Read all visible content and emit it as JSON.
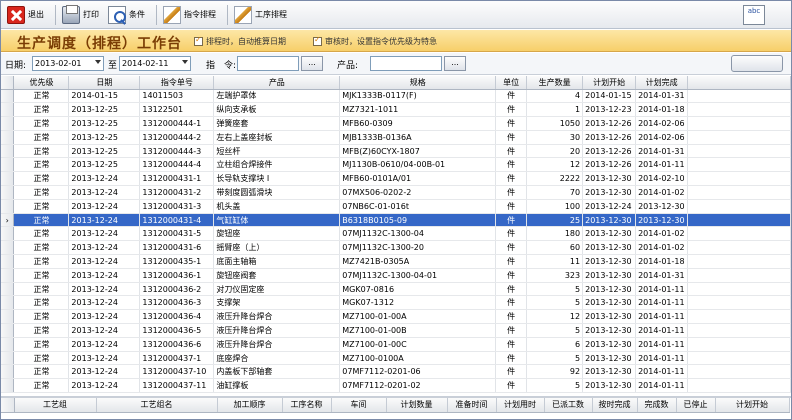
{
  "toolbar": {
    "exit": "退出",
    "print": "打印",
    "condition": "条件",
    "instruction_sort": "指令排程",
    "process_sort": "工序排程",
    "spell_icon_text": "abc"
  },
  "title": {
    "page_title": "生产调度（排程）工作台",
    "option1": "排程时，自动推算日期",
    "option2": "审核时，设置指令优先级为特急"
  },
  "filter": {
    "date_label": "日期:",
    "date_from": "2013-02-01",
    "to_label": "至",
    "date_to": "2014-02-11",
    "instruction_label": "指　令:",
    "dots": "...",
    "product_label": "产品:"
  },
  "grid": {
    "columns": [
      "优先级",
      "日期",
      "指令单号",
      "产品",
      "规格",
      "单位",
      "生产数量",
      "计划开始",
      "计划完成"
    ],
    "selected_index": 9,
    "rows": [
      [
        "正常",
        "2014-01-15",
        "14011503",
        "左端护罩体",
        "MJK1333B-0117(F)",
        "件",
        "4",
        "2014-01-15",
        "2014-01-31"
      ],
      [
        "正常",
        "2013-12-25",
        "13122501",
        "纵向支承板",
        "MZ7321-1011",
        "件",
        "1",
        "2013-12-23",
        "2014-01-18"
      ],
      [
        "正常",
        "2013-12-25",
        "1312000444-1",
        "弹簧座套",
        "MFB60-0309",
        "件",
        "1050",
        "2013-12-26",
        "2014-02-06"
      ],
      [
        "正常",
        "2013-12-25",
        "1312000444-2",
        "左右上盖座封板",
        "MJB1333B-0136A",
        "件",
        "30",
        "2013-12-26",
        "2014-02-06"
      ],
      [
        "正常",
        "2013-12-25",
        "1312000444-3",
        "短丝杆",
        "MFB(Z)60CYX-1807",
        "件",
        "20",
        "2013-12-26",
        "2014-01-31"
      ],
      [
        "正常",
        "2013-12-25",
        "1312000444-4",
        "立柱组合焊接件",
        "MJ1130B-0610/04-00B-01",
        "件",
        "12",
        "2013-12-26",
        "2014-01-11"
      ],
      [
        "正常",
        "2013-12-24",
        "1312000431-1",
        "长导轨支撑块 I",
        "MFB60-0101A/01",
        "件",
        "2222",
        "2013-12-30",
        "2014-02-10"
      ],
      [
        "正常",
        "2013-12-24",
        "1312000431-2",
        "带刻度圆弧滑块",
        "07MX506-0202-2",
        "件",
        "70",
        "2013-12-30",
        "2014-01-02"
      ],
      [
        "正常",
        "2013-12-24",
        "1312000431-3",
        "机头盖",
        "07NB6C-01-016t",
        "件",
        "100",
        "2013-12-24",
        "2013-12-30"
      ],
      [
        "正常",
        "2013-12-24",
        "1312000431-4",
        "气缸缸体",
        "B6318B0105-09",
        "件",
        "25",
        "2013-12-30",
        "2013-12-30"
      ],
      [
        "正常",
        "2013-12-24",
        "1312000431-5",
        "旋钮座",
        "07MJ1132C-1300-04",
        "件",
        "180",
        "2013-12-30",
        "2014-01-02"
      ],
      [
        "正常",
        "2013-12-24",
        "1312000431-6",
        "摇臂座（上）",
        "07MJ1132C-1300-20",
        "件",
        "60",
        "2013-12-30",
        "2014-01-02"
      ],
      [
        "正常",
        "2013-12-24",
        "1312000435-1",
        "底面主轴箱",
        "MZ7421B-0305A",
        "件",
        "11",
        "2013-12-30",
        "2014-01-18"
      ],
      [
        "正常",
        "2013-12-24",
        "1312000436-1",
        "旋钮座阀套",
        "07MJ1132C-1300-04-01",
        "件",
        "323",
        "2013-12-30",
        "2014-01-31"
      ],
      [
        "正常",
        "2013-12-24",
        "1312000436-2",
        "对刀仪固定座",
        "MGK07-0816",
        "件",
        "5",
        "2013-12-30",
        "2014-01-11"
      ],
      [
        "正常",
        "2013-12-24",
        "1312000436-3",
        "支撑架",
        "MGK07-1312",
        "件",
        "5",
        "2013-12-30",
        "2014-01-11"
      ],
      [
        "正常",
        "2013-12-24",
        "1312000436-4",
        "液压升降台焊合",
        "MZ7100-01-00A",
        "件",
        "12",
        "2013-12-30",
        "2014-01-11"
      ],
      [
        "正常",
        "2013-12-24",
        "1312000436-5",
        "液压升降台焊合",
        "MZ7100-01-00B",
        "件",
        "5",
        "2013-12-30",
        "2014-01-11"
      ],
      [
        "正常",
        "2013-12-24",
        "1312000436-6",
        "液压升降台焊合",
        "MZ7100-01-00C",
        "件",
        "6",
        "2013-12-30",
        "2014-01-11"
      ],
      [
        "正常",
        "2013-12-24",
        "1312000437-1",
        "底座焊合",
        "MZ7100-0100A",
        "件",
        "5",
        "2013-12-30",
        "2014-01-11"
      ],
      [
        "正常",
        "2013-12-24",
        "1312000437-10",
        "内盖板下部轴套",
        "07MF7112-0201-06",
        "件",
        "92",
        "2013-12-30",
        "2014-01-11"
      ],
      [
        "正常",
        "2013-12-24",
        "1312000437-11",
        "油缸撑板",
        "07MF7112-0201-02",
        "件",
        "5",
        "2013-12-30",
        "2014-01-11"
      ]
    ]
  },
  "bottom_grid": {
    "columns": [
      "工艺组",
      "工艺组名",
      "加工顺序",
      "工序名称",
      "车间",
      "计划数量",
      "准备时间",
      "计划用时",
      "已派工数",
      "按时完成",
      "完成数",
      "已停止",
      "计划开始"
    ]
  }
}
